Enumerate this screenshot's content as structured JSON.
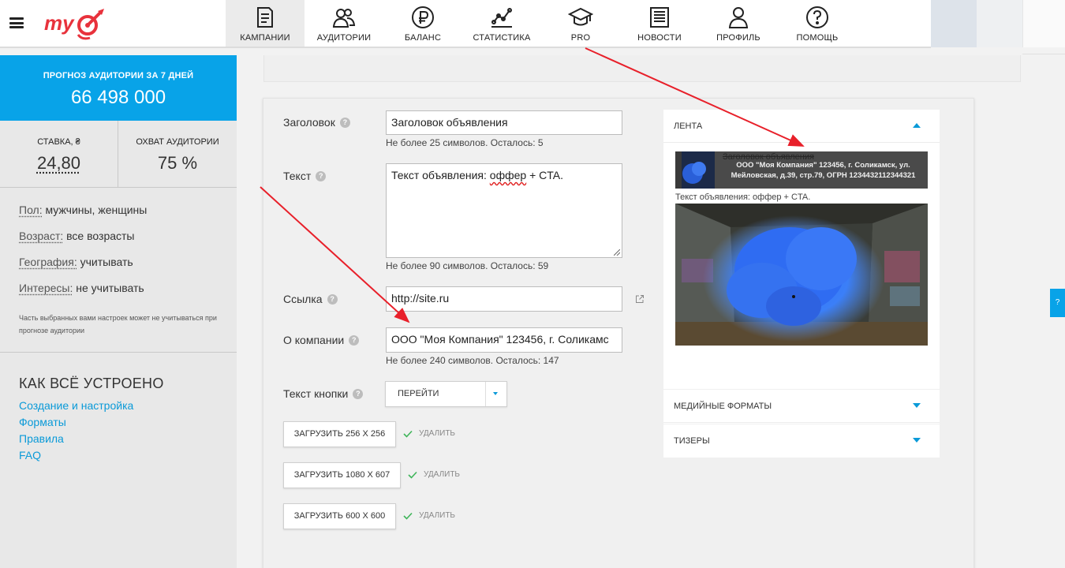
{
  "nav": {
    "items": [
      {
        "label": "КАМПАНИИ",
        "icon": "campaigns-icon",
        "active": true
      },
      {
        "label": "АУДИТОРИИ",
        "icon": "audiences-icon",
        "active": false
      },
      {
        "label": "БАЛАНС",
        "icon": "ruble-icon",
        "active": false
      },
      {
        "label": "СТАТИСТИКА",
        "icon": "statistics-icon",
        "active": false
      },
      {
        "label": "PRO",
        "icon": "graduation-cap-icon",
        "active": false
      },
      {
        "label": "НОВОСТИ",
        "icon": "news-icon",
        "active": false
      },
      {
        "label": "ПРОФИЛЬ",
        "icon": "profile-icon",
        "active": false
      },
      {
        "label": "ПОМОЩЬ",
        "icon": "help-icon",
        "active": false
      }
    ]
  },
  "sidebar": {
    "forecast_label": "ПРОГНОЗ АУДИТОРИИ ЗА 7 ДНЕЙ",
    "forecast_value": "66 498 000",
    "rate_label": "СТАВКА, ₴",
    "rate_value": "24,80",
    "reach_label": "ОХВАТ АУДИТОРИИ",
    "reach_value": "75 %",
    "params": [
      {
        "key": "Пол:",
        "value": "мужчины, женщины"
      },
      {
        "key": "Возраст:",
        "value": "все возрасты"
      },
      {
        "key": "География:",
        "value": "учитывать"
      },
      {
        "key": "Интересы:",
        "value": "не учитывать"
      }
    ],
    "note": "Часть выбранных вами настроек может не учитываться при прогнозе аудитории",
    "how_title": "КАК ВСЁ УСТРОЕНО",
    "links": [
      "Создание и настройка",
      "Форматы",
      "Правила",
      "FAQ"
    ]
  },
  "form": {
    "title_label": "Заголовок",
    "title_value": "Заголовок объявления",
    "title_hint": "Не более  25  символов. Осталось: 5",
    "text_label": "Текст",
    "text_value_prefix": "Текст объявления: ",
    "text_value_spell": "оффер",
    "text_value_suffix": " + CTA.",
    "text_hint": "Не более  90  символов. Осталось: 59",
    "link_label": "Ссылка",
    "link_value": "http://site.ru",
    "company_label": "О компании",
    "company_value": "ООО \"Моя Компания\"  123456, г. Соликамс",
    "company_hint": "Не более  240  символов. Осталось: 147",
    "button_text_label": "Текст кнопки",
    "button_text_value": "ПЕРЕЙТИ",
    "uploads": [
      {
        "label": "ЗАГРУЗИТЬ 256 X 256",
        "status": "УДАЛИТЬ"
      },
      {
        "label": "ЗАГРУЗИТЬ 1080 X 607",
        "status": "УДАЛИТЬ"
      },
      {
        "label": "ЗАГРУЗИТЬ 600 X 600",
        "status": "УДАЛИТЬ"
      }
    ]
  },
  "preview": {
    "feed_title": "ЛЕНТА",
    "ad_title": "Заголовок объявления",
    "ad_company": "ООО \"Моя Компания\" 123456, г. Соликамск, ул. Мейловская, д.39, стр.79, ОГРН 1234432112344321",
    "ad_text": "Текст объявления: оффер + CTA.",
    "media_title": "МЕДИЙНЫЕ ФОРМАТЫ",
    "teasers_title": "ТИЗЕРЫ"
  },
  "side_tab": "?",
  "colors": {
    "accent": "#08a3e8",
    "link": "#0a9ad8",
    "logo": "#e8323c",
    "arrow": "#e8202a"
  }
}
